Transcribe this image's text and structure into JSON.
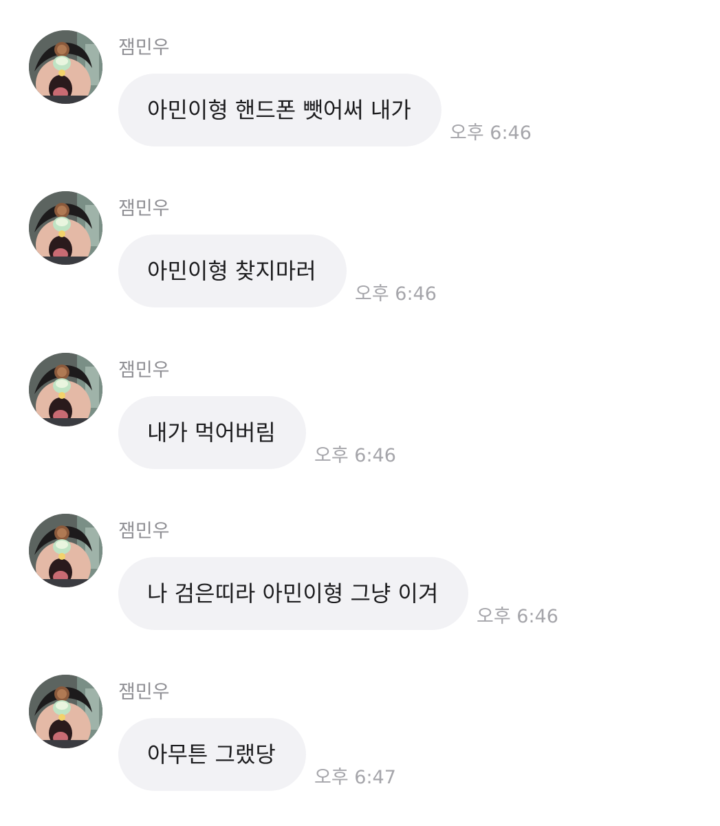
{
  "messages": [
    {
      "sender": "잼민우",
      "text": "아민이형 핸드폰 뺏어써 내가",
      "time": "오후 6:46",
      "avatar_icon": "profile-photo-icon"
    },
    {
      "sender": "잼민우",
      "text": "아민이형 찾지마러",
      "time": "오후 6:46",
      "avatar_icon": "profile-photo-icon"
    },
    {
      "sender": "잼민우",
      "text": "내가 먹어버림",
      "time": "오후 6:46",
      "avatar_icon": "profile-photo-icon"
    },
    {
      "sender": "잼민우",
      "text": "나 검은띠라 아민이형 그냥 이겨",
      "time": "오후 6:46",
      "avatar_icon": "profile-photo-icon"
    },
    {
      "sender": "잼민우",
      "text": "아무튼 그랬당",
      "time": "오후 6:47",
      "avatar_icon": "profile-photo-icon"
    }
  ],
  "colors": {
    "bubble": "#f2f2f5",
    "message_text": "#1c1c1e",
    "sender_text": "#8e8e93",
    "time_text": "#a5a5aa"
  }
}
